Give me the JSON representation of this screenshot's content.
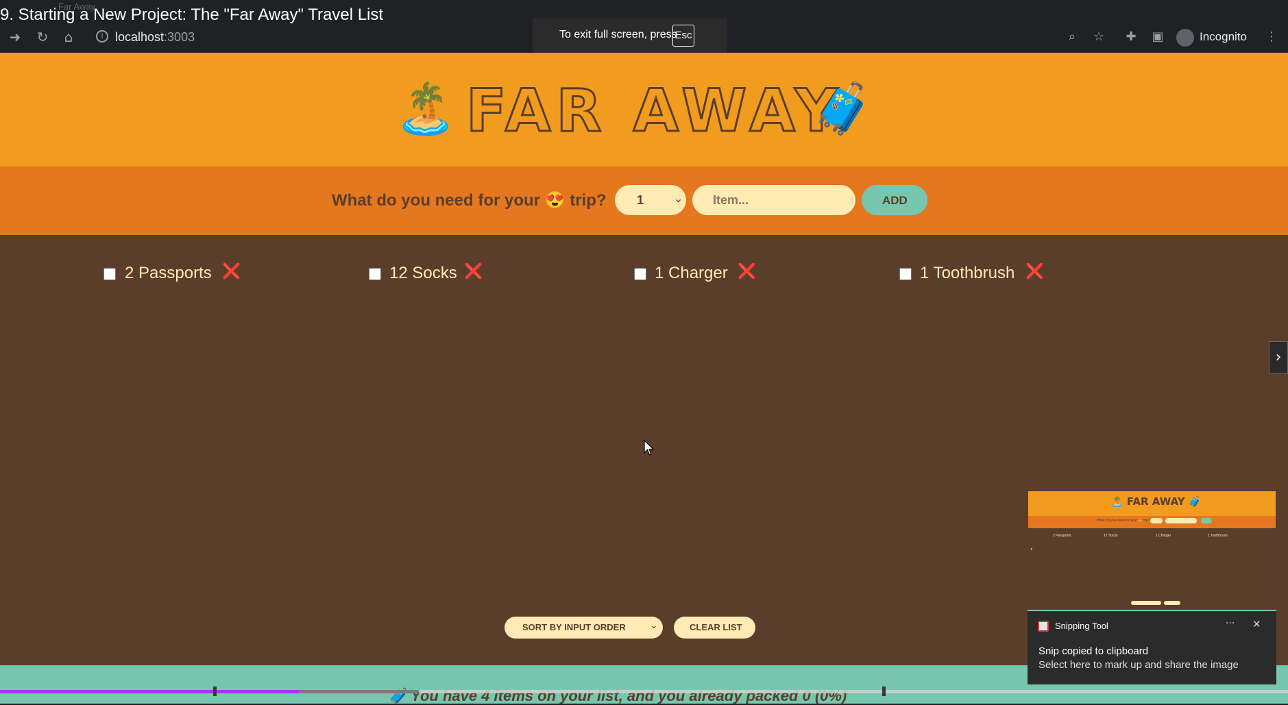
{
  "video": {
    "title": "9. Starting a New Project: The \"Far Away\" Travel List"
  },
  "browser": {
    "tab_title": "Far Away",
    "url_host": "localhost",
    "url_port": ":3003",
    "profile_label": "Incognito",
    "fullscreen_notice": "To exit full screen, press",
    "fullscreen_key": "Esc",
    "icons": [
      "back-arrow-icon",
      "forward-arrow-icon",
      "reload-icon",
      "home-icon",
      "info-icon",
      "zoom-icon",
      "star-icon",
      "extensions-icon",
      "side-panel-icon",
      "incognito-icon",
      "menu-dots-icon"
    ]
  },
  "app": {
    "logo": {
      "title": "FAR AWAY",
      "left_emoji": "🏝️",
      "right_emoji": "🧳"
    },
    "form": {
      "question": "What do you need for your 😍 trip?",
      "quantity_selected": "1",
      "item_placeholder": "Item...",
      "add_label": "ADD"
    },
    "items": [
      {
        "quantity": 2,
        "label": "2 Passports",
        "packed": false,
        "delete_glyph": "❌"
      },
      {
        "quantity": 12,
        "label": "12 Socks",
        "packed": false,
        "delete_glyph": "❌"
      },
      {
        "quantity": 1,
        "label": "1 Charger",
        "packed": false,
        "delete_glyph": "❌"
      },
      {
        "quantity": 1,
        "label": "1 Toothbrush",
        "packed": false,
        "delete_glyph": "❌"
      }
    ],
    "actions": {
      "sort_selected": "SORT BY INPUT ORDER",
      "clear_label": "CLEAR LIST"
    },
    "stats": {
      "text": "🧳 You have 4 items on your list, and you already packed 0 (0%)"
    },
    "colors": {
      "header_bg": "#f29c1f",
      "form_bg": "#e5771f",
      "list_bg": "#5a3e2b",
      "stats_bg": "#76c7ad",
      "pill_bg": "#ffebb3",
      "text_dark": "#5a3e2b",
      "delete_red": "#e5161f"
    }
  },
  "player": {
    "progress_played": 0.232,
    "progress_buffered": 0.325
  },
  "toast": {
    "app_name": "Snipping Tool",
    "heading": "Snip copied to clipboard",
    "message": "Select here to mark up and share the image",
    "more_glyph": "···",
    "close_glyph": "✕",
    "thumb_title": "🏝️ FAR AWAY 🧳"
  }
}
